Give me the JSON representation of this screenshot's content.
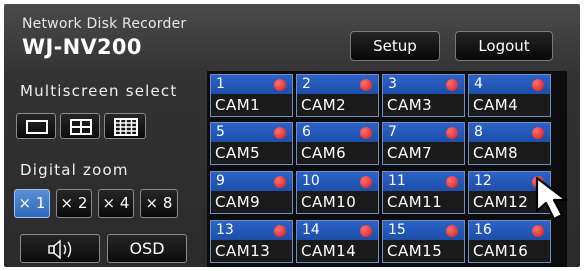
{
  "header": {
    "subtitle": "Network Disk Recorder",
    "model": "WJ-NV200",
    "setup_label": "Setup",
    "logout_label": "Logout"
  },
  "multiscreen": {
    "title": "Multiscreen select",
    "buttons": [
      {
        "icon": "single-screen-icon"
      },
      {
        "icon": "quad-screen-icon"
      },
      {
        "icon": "grid-16-screen-icon"
      }
    ]
  },
  "zoom": {
    "title": "Digital zoom",
    "options": [
      "× 1",
      "× 2",
      "× 4",
      "× 8"
    ],
    "selected": "× 1"
  },
  "bottom": {
    "audio_icon": "speaker-icon",
    "osd_label": "OSD"
  },
  "cameras": [
    {
      "number": "1",
      "name": "CAM1"
    },
    {
      "number": "2",
      "name": "CAM2"
    },
    {
      "number": "3",
      "name": "CAM3"
    },
    {
      "number": "4",
      "name": "CAM4"
    },
    {
      "number": "5",
      "name": "CAM5"
    },
    {
      "number": "6",
      "name": "CAM6"
    },
    {
      "number": "7",
      "name": "CAM7"
    },
    {
      "number": "8",
      "name": "CAM8"
    },
    {
      "number": "9",
      "name": "CAM9"
    },
    {
      "number": "10",
      "name": "CAM10"
    },
    {
      "number": "11",
      "name": "CAM11"
    },
    {
      "number": "12",
      "name": "CAM12"
    },
    {
      "number": "13",
      "name": "CAM13"
    },
    {
      "number": "14",
      "name": "CAM14"
    },
    {
      "number": "15",
      "name": "CAM15"
    },
    {
      "number": "16",
      "name": "CAM16"
    }
  ],
  "colors": {
    "panel": "#333333",
    "accent_blue": "#2c63c9",
    "recording_dot": "#d01818",
    "active_zoom": "#3f7cd0"
  }
}
